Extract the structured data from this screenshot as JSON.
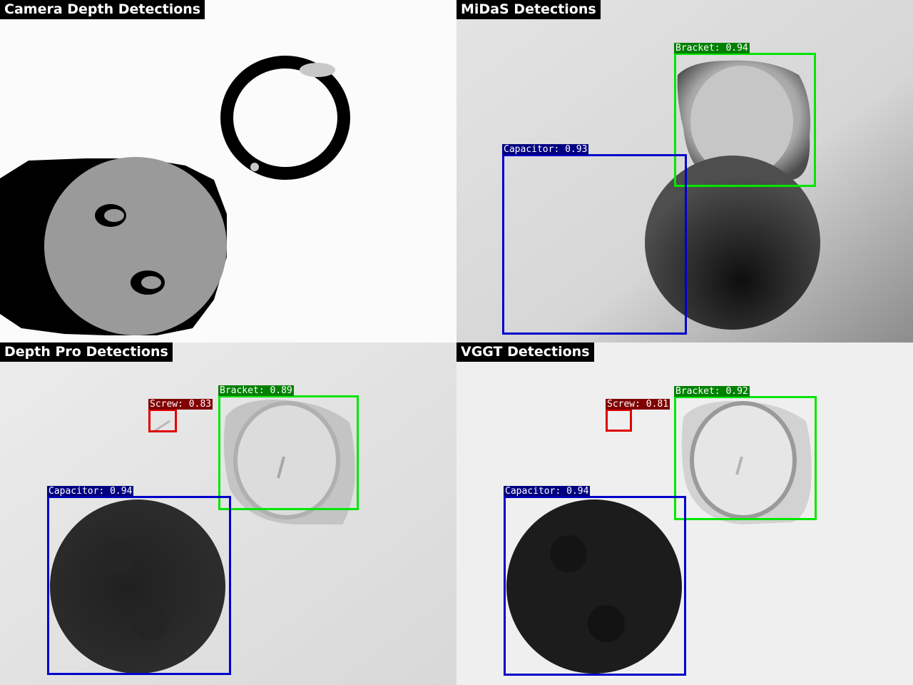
{
  "colors": {
    "capacitor": "#0000cc",
    "capacitor_label_bg": "#000080",
    "bracket": "#00e600",
    "bracket_label_bg": "#008000",
    "screw": "#e00000",
    "screw_label_bg": "#800000"
  },
  "panels": {
    "camera": {
      "title": "Camera Depth Detections"
    },
    "midas": {
      "title": "MiDaS Detections",
      "detections": [
        {
          "cls": "bracket",
          "label": "Bracket: 0.94"
        },
        {
          "cls": "capacitor",
          "label": "Capacitor: 0.93"
        }
      ]
    },
    "depthpro": {
      "title": "Depth Pro Detections",
      "detections": [
        {
          "cls": "screw",
          "label": "Screw: 0.83"
        },
        {
          "cls": "bracket",
          "label": "Bracket: 0.89"
        },
        {
          "cls": "capacitor",
          "label": "Capacitor: 0.94"
        }
      ]
    },
    "vggt": {
      "title": "VGGT Detections",
      "detections": [
        {
          "cls": "screw",
          "label": "Screw: 0.81"
        },
        {
          "cls": "bracket",
          "label": "Bracket: 0.92"
        },
        {
          "cls": "capacitor",
          "label": "Capacitor: 0.94"
        }
      ]
    }
  }
}
